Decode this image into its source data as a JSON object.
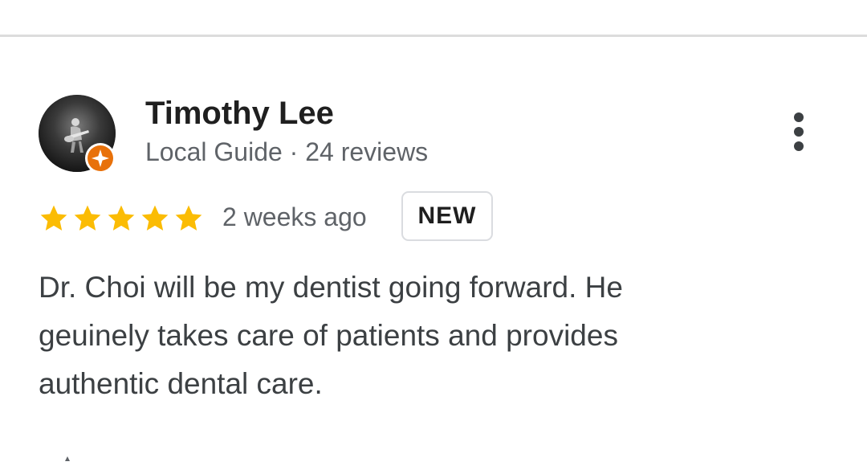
{
  "reviewer": {
    "name": "Timothy Lee",
    "meta": "Local Guide · 24 reviews",
    "avatar_icon": "profile-photo",
    "badge_icon": "local-guide-star-badge"
  },
  "review": {
    "rating": 5,
    "rating_max": 5,
    "time_ago": "2 weeks ago",
    "new_badge": "NEW",
    "text_lines": [
      "Dr. Choi will be my dentist going forward. He",
      "geuinely takes care of patients and provides",
      "authentic dental care."
    ]
  },
  "actions": {
    "more_icon": "more-vert-icon"
  },
  "colors": {
    "star": "#fbbc04",
    "badge": "#e8710a",
    "name": "#1f1f1f",
    "secondary_text": "#5f6368",
    "body_text": "#3c4043",
    "divider": "#dcdcdc"
  }
}
